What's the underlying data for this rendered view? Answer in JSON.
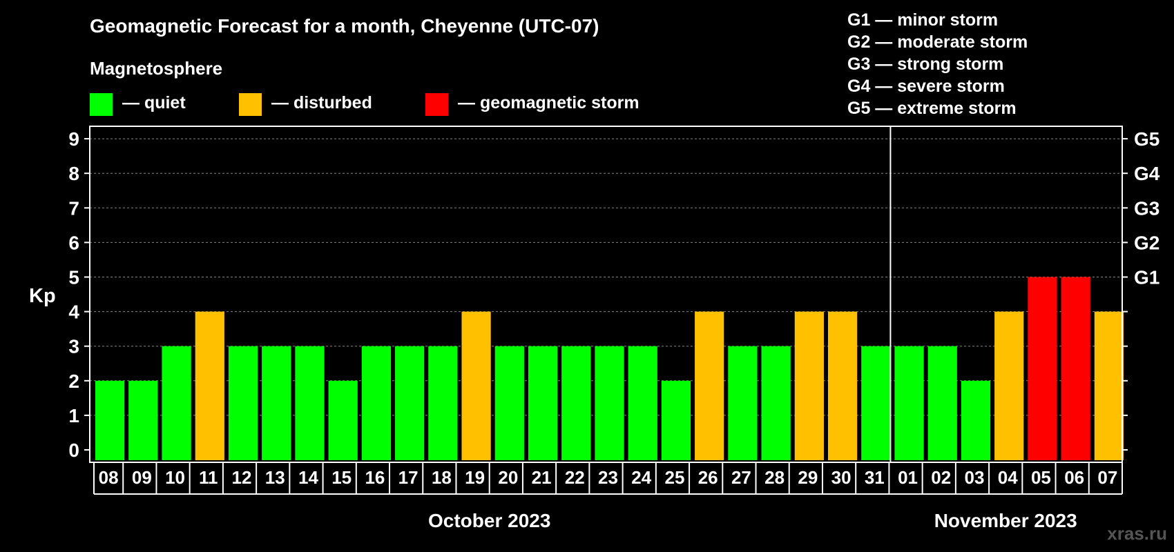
{
  "chart_data": {
    "type": "bar",
    "title": "Geomagnetic Forecast for a month, Cheyenne (UTC-07)",
    "subtitle": "Magnetosphere",
    "ylabel": "Kp",
    "ylim": [
      0,
      9
    ],
    "yticks": [
      "0",
      "1",
      "2",
      "3",
      "4",
      "5",
      "6",
      "7",
      "8",
      "9"
    ],
    "grid": true,
    "legend": [
      {
        "label": "— quiet",
        "color": "#00ff00"
      },
      {
        "label": "— disturbed",
        "color": "#ffc000"
      },
      {
        "label": "— geomagnetic storm",
        "color": "#ff0000"
      }
    ],
    "storm_scale": [
      {
        "level": "G1",
        "kp": 5,
        "text": "G1 — minor storm"
      },
      {
        "level": "G2",
        "kp": 6,
        "text": "G2 — moderate storm"
      },
      {
        "level": "G3",
        "kp": 7,
        "text": "G3 — strong storm"
      },
      {
        "level": "G4",
        "kp": 8,
        "text": "G4 — severe storm"
      },
      {
        "level": "G5",
        "kp": 9,
        "text": "G5 — extreme storm"
      }
    ],
    "categories": [
      "08",
      "09",
      "10",
      "11",
      "12",
      "13",
      "14",
      "15",
      "16",
      "17",
      "18",
      "19",
      "20",
      "21",
      "22",
      "23",
      "24",
      "25",
      "26",
      "27",
      "28",
      "29",
      "30",
      "31",
      "01",
      "02",
      "03",
      "04",
      "05",
      "06",
      "07"
    ],
    "values": [
      2,
      2,
      3,
      4,
      3,
      3,
      3,
      2,
      3,
      3,
      3,
      4,
      3,
      3,
      3,
      3,
      3,
      2,
      4,
      3,
      3,
      4,
      4,
      3,
      3,
      3,
      2,
      4,
      5,
      5,
      4
    ],
    "months": [
      {
        "label": "October 2023",
        "start": 0,
        "count": 24
      },
      {
        "label": "November 2023",
        "start": 24,
        "count": 7
      }
    ],
    "colors": {
      "quiet": "#00ff00",
      "disturbed": "#ffc000",
      "storm": "#ff0000"
    }
  },
  "watermark": "xras.ru"
}
